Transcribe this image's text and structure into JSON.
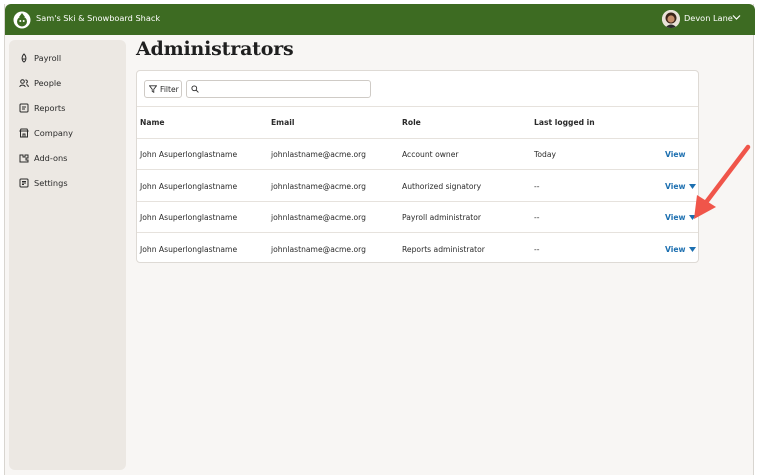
{
  "app": {
    "company": "Sam's Ski & Snowboard Shack",
    "user": "Devon Lane",
    "brand_color": "#3d6b22",
    "link_color": "#1c6fb0",
    "annotation_color": "#f0554a"
  },
  "sidebar": {
    "items": [
      {
        "label": "Payroll",
        "icon": "payroll-icon"
      },
      {
        "label": "People",
        "icon": "people-icon"
      },
      {
        "label": "Reports",
        "icon": "reports-icon"
      },
      {
        "label": "Company",
        "icon": "company-icon"
      },
      {
        "label": "Add-ons",
        "icon": "addons-icon"
      },
      {
        "label": "Settings",
        "icon": "settings-icon"
      }
    ]
  },
  "page": {
    "title": "Administrators"
  },
  "toolbar": {
    "filter_label": "Filter",
    "search_placeholder": ""
  },
  "table": {
    "headers": {
      "name": "Name",
      "email": "Email",
      "role": "Role",
      "last": "Last logged in"
    },
    "rows": [
      {
        "name": "John Asuperlonglastname",
        "email": "johnlastname@acme.org",
        "role": "Account owner",
        "last": "Today",
        "action": "View",
        "dropdown": false
      },
      {
        "name": "John Asuperlonglastname",
        "email": "johnlastname@acme.org",
        "role": "Authorized signatory",
        "last": "--",
        "action": "View",
        "dropdown": true
      },
      {
        "name": "John Asuperlonglastname",
        "email": "johnlastname@acme.org",
        "role": "Payroll administrator",
        "last": "--",
        "action": "View",
        "dropdown": true
      },
      {
        "name": "John Asuperlonglastname",
        "email": "johnlastname@acme.org",
        "role": "Reports administrator",
        "last": "--",
        "action": "View",
        "dropdown": true
      }
    ]
  }
}
